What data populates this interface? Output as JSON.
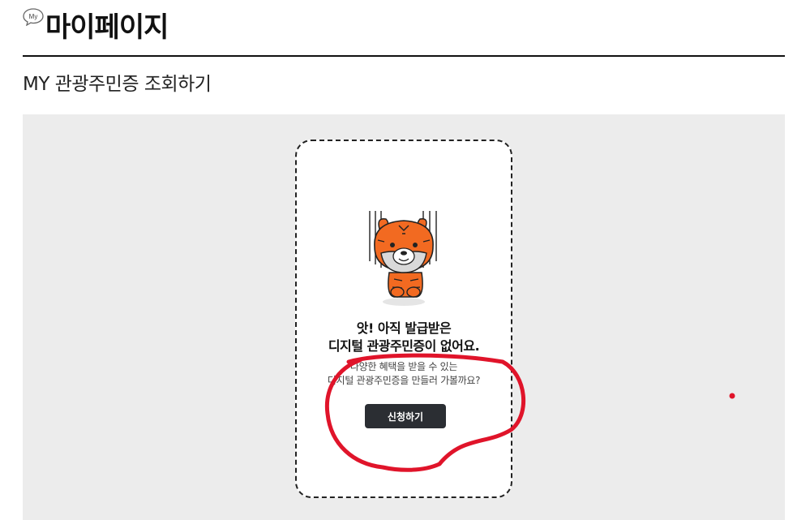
{
  "header": {
    "icon_label": "My",
    "title": "마이페이지"
  },
  "section": {
    "title": "MY 관광주민증 조회하기"
  },
  "card": {
    "mascot_icon": "tiger-mascot-icon",
    "title_line1": "앗! 아직 발급받은",
    "title_line2": "디지털 관광주민증이 없어요.",
    "desc_line1": "다양한 혜택을 받을 수 있는",
    "desc_line2": "디지털 관광주민증을 만들러 가볼까요?",
    "apply_label": "신청하기"
  },
  "colors": {
    "annotation": "#e0142a",
    "button": "#2b2e33",
    "content_bg": "#ececec",
    "mascot_orange": "#f26a21"
  }
}
